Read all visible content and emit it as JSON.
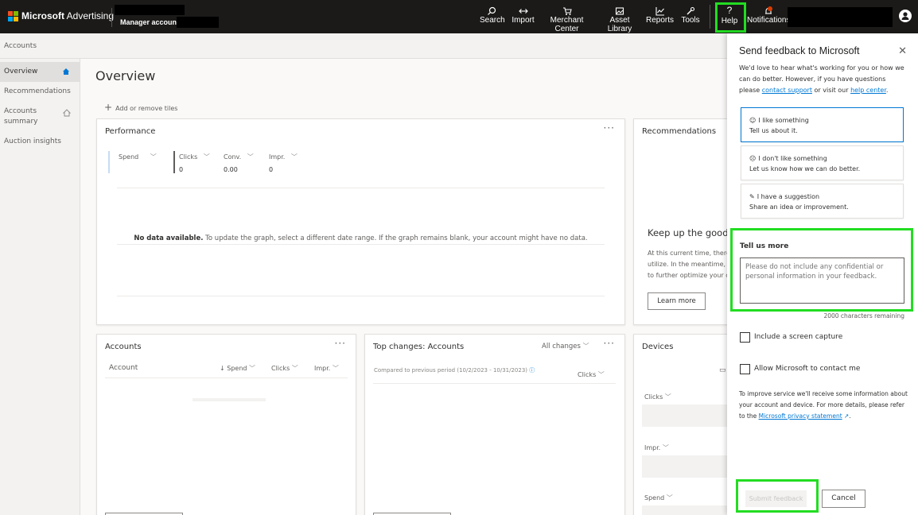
{
  "topbar": {
    "brand_name": "Microsoft",
    "brand_product": "Advertising",
    "account_label": "Manager account",
    "nav": [
      {
        "label": "Search",
        "icon": "search-icon"
      },
      {
        "label": "Import",
        "icon": "import-icon"
      },
      {
        "label": "Merchant Center",
        "icon": "cart-icon"
      },
      {
        "label": "Asset Library",
        "icon": "asset-library-icon"
      },
      {
        "label": "Reports",
        "icon": "chart-icon"
      },
      {
        "label": "Tools",
        "icon": "wrench-icon"
      },
      {
        "label": "Help",
        "icon": "question-icon"
      },
      {
        "label": "Notifications",
        "icon": "bell-icon"
      }
    ],
    "logo_colors": [
      "#f25022",
      "#7fba00",
      "#00a4ef",
      "#ffb900"
    ]
  },
  "breadcrumb": "Accounts",
  "sidebar": {
    "items": [
      {
        "label": "Overview",
        "active": true,
        "icon": "home-icon"
      },
      {
        "label": "Recommendations"
      },
      {
        "label": "Accounts summary",
        "icon": "home-outline-icon"
      },
      {
        "label": "Auction insights"
      }
    ]
  },
  "main": {
    "title": "Overview",
    "add_tiles": "Add or remove tiles",
    "performance": {
      "title": "Performance",
      "more": "···",
      "metrics": [
        {
          "label": "Spend",
          "value": ""
        },
        {
          "label": "Clicks",
          "value": "0"
        },
        {
          "label": "Conv.",
          "value": "0.00"
        },
        {
          "label": "Impr.",
          "value": "0"
        }
      ],
      "nodata_bold": "No data available.",
      "nodata_text": " To update the graph, select a different date range. If the graph remains blank, your account might have no data."
    },
    "recommendations": {
      "title": "Recommendations",
      "heading": "Keep up the good w",
      "body_lines": [
        "At this current time, there",
        "utilize. In the meantime, v",
        "to further optimize your c"
      ],
      "button": "Learn more"
    },
    "accounts": {
      "title": "Accounts",
      "more": "···",
      "columns": [
        "Account",
        "Spend",
        "Clicks",
        "Impr."
      ]
    },
    "top_changes": {
      "title": "Top changes: Accounts",
      "filter": "All changes",
      "more": "···",
      "compare": "Compared to previous period (10/2/2023 - 10/31/2023)",
      "metric": "Clicks"
    },
    "devices": {
      "title": "Devices",
      "metrics": [
        "Clicks",
        "Impr.",
        "Spend"
      ]
    }
  },
  "feedback": {
    "title": "Send feedback to Microsoft",
    "intro_1": "We'd love to hear what's working for you or how we can do better. However, if you have questions please ",
    "contact_link": "contact support",
    "intro_2": " or visit our ",
    "help_link": "help center",
    "intro_3": ".",
    "options": [
      {
        "title": "I like something",
        "sub": "Tell us about it.",
        "icon": "smile-icon",
        "selected": true
      },
      {
        "title": "I don't like something",
        "sub": "Let us know how we can do better.",
        "icon": "frown-icon",
        "selected": false
      },
      {
        "title": "I have a suggestion",
        "sub": "Share an idea or improvement.",
        "icon": "suggestion-icon",
        "selected": false
      }
    ],
    "tell_more_label": "Tell us more",
    "textarea_placeholder": "Please do not include any confidential or personal information in your feedback.",
    "remaining": "2000 characters remaining",
    "screen_capture_label": "Include a screen capture",
    "contact_me_label": "Allow Microsoft to contact me",
    "privacy_1": "To improve service we'll receive some information about your account and device. For more details, please refer to the ",
    "privacy_link": "Microsoft privacy statement",
    "privacy_2": ".",
    "submit": "Submit feedback",
    "cancel": "Cancel"
  },
  "colors": {
    "highlight": "#22dd22",
    "accent": "#0078d4",
    "topbar": "#1b1a19"
  }
}
